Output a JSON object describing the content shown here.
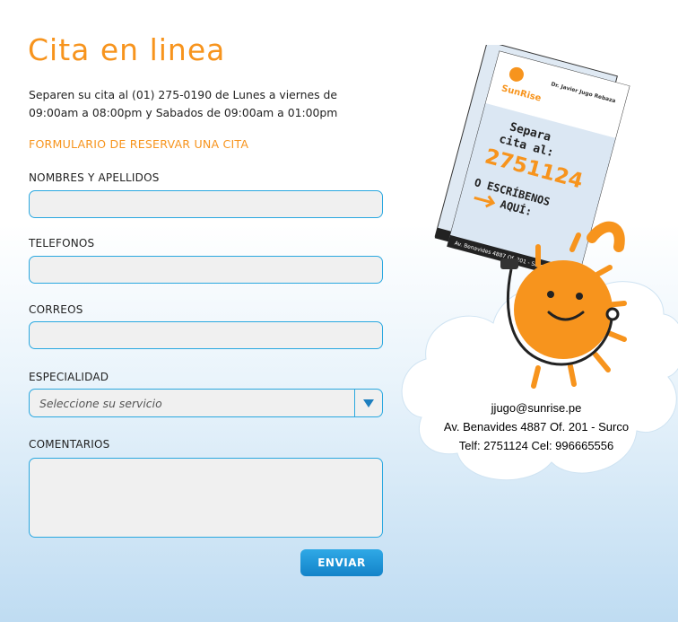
{
  "header": {
    "title": "Cita en linea",
    "intro": "Separen su cita al (01) 275-0190 de Lunes a viernes de 09:00am a 08:00pm y Sabados de 09:00am a 01:00pm"
  },
  "form": {
    "title": "FORMULARIO DE RESERVAR UNA CITA",
    "names_label": "NOMBRES Y APELLIDOS",
    "phones_label": "TELEFONOS",
    "email_label": "CORREOS",
    "specialty_label": "ESPECIALIDAD",
    "specialty_placeholder": "Seleccione su servicio",
    "comments_label": "COMENTARIOS",
    "submit_label": "ENVIAR"
  },
  "flyer": {
    "brand": "SunRise",
    "doctor": "Dr. Javier Jugo Rebaza",
    "line1": "Separa",
    "line2": "cita al:",
    "number": "2751124",
    "line3": "O ESCRÍBENOS",
    "line4": "AQUÍ:",
    "footer": "Av. Benavides 4887 Of. 201 - Surco"
  },
  "contact": {
    "email": "jjugo@sunrise.pe",
    "address": "Av. Benavides 4887 Of. 201 -  Surco",
    "phones": "Telf: 2751124   Cel: 996665556"
  },
  "colors": {
    "accent": "#f7941d",
    "field_border": "#2aa8e0",
    "button": "#1b8fd3"
  }
}
